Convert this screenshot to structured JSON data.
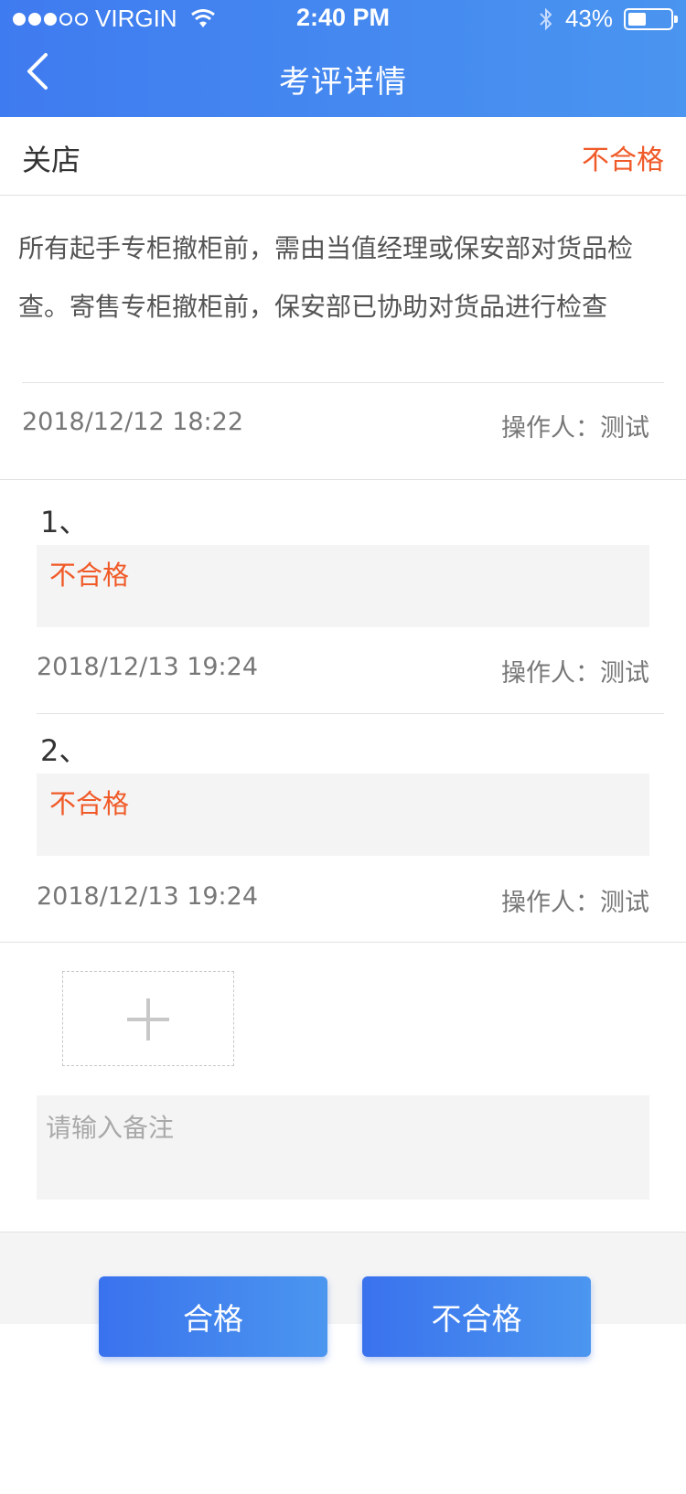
{
  "status_bar": {
    "carrier": "VIRGIN",
    "time": "2:40 PM",
    "battery": "43%",
    "battery_level": 0.43,
    "signal_bars_filled": 3,
    "signal_bars_total": 5
  },
  "nav": {
    "title": "考评详情",
    "back_icon": "chevron-left-icon"
  },
  "store": {
    "name": "关店",
    "status": "不合格"
  },
  "description": "所有起手专柜撤柜前，需由当值经理或保安部对货品检查。寄售专柜撤柜前，保安部已协助对货品进行检查",
  "main_meta": {
    "time": "2018/12/12 18:22",
    "operator": "操作人：测试"
  },
  "records": [
    {
      "index": "1、",
      "result": "不合格",
      "time": "2018/12/13 19:24",
      "operator": "操作人：测试"
    },
    {
      "index": "2、",
      "result": "不合格",
      "time": "2018/12/13 19:24",
      "operator": "操作人：测试"
    }
  ],
  "upload": {
    "icon": "plus-icon"
  },
  "note": {
    "placeholder": "请输入备注",
    "value": ""
  },
  "actions": {
    "pass_label": "合格",
    "fail_label": "不合格"
  },
  "colors": {
    "header_start": "#3f7bf0",
    "header_end": "#4a95f0",
    "fail_red": "#f05a28",
    "button_blue": "#3a72ee"
  }
}
